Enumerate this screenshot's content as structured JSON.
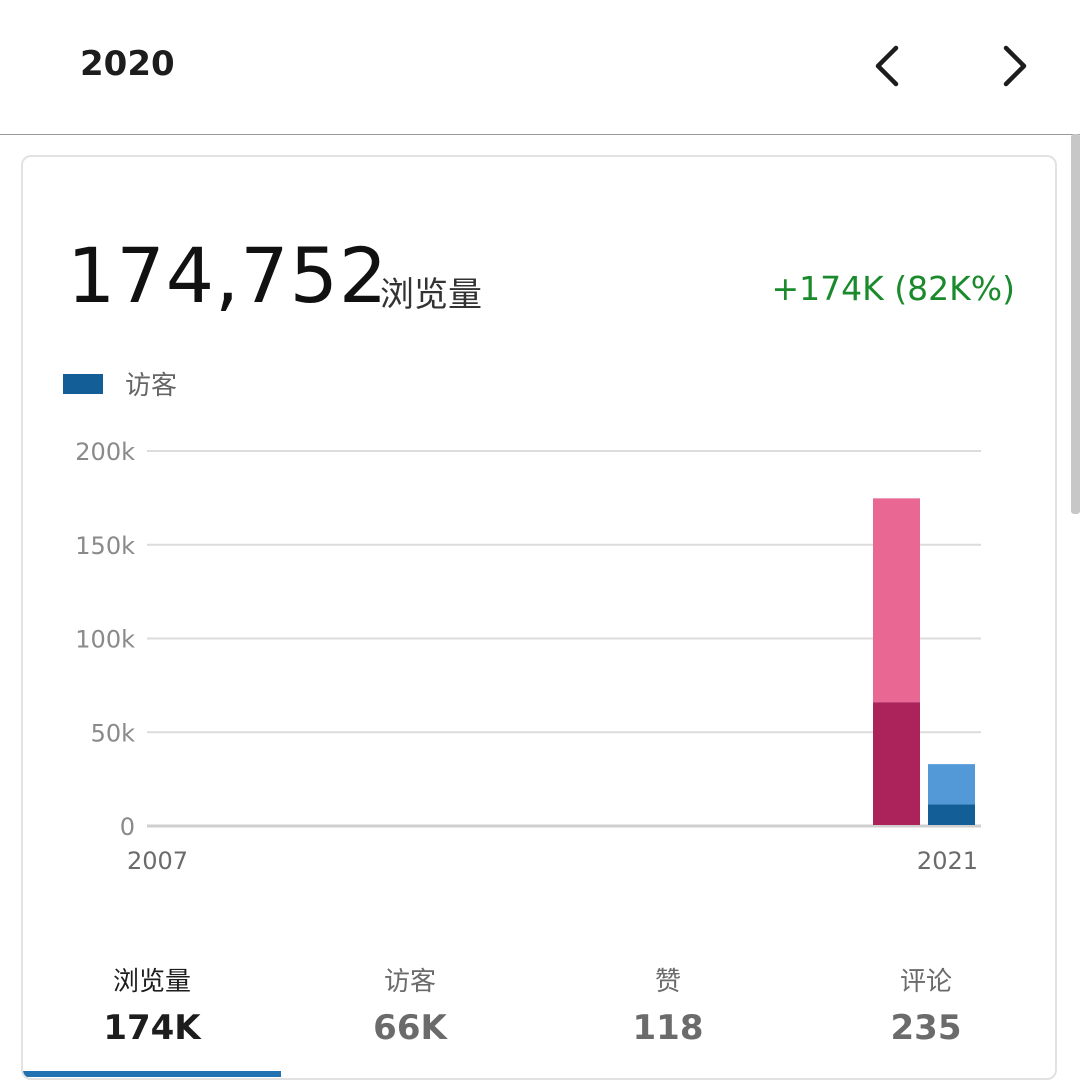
{
  "header": {
    "year": "2020",
    "prev_icon": "chevron-left-icon",
    "next_icon": "chevron-right-icon"
  },
  "summary": {
    "total": "174,752",
    "label": "浏览量",
    "change": "+174K (82K%)"
  },
  "legend": {
    "label": "访客",
    "color": "#135e96"
  },
  "colors": {
    "views_light": "#e96893",
    "views_dark": "#ab235a",
    "visitors_light": "#5399d7",
    "visitors_dark": "#135e96",
    "change_green": "#1a8a2c",
    "accent": "#2271b1"
  },
  "chart_data": {
    "type": "bar",
    "categories": [
      "2007",
      "2021"
    ],
    "ylim": [
      0,
      200000
    ],
    "yticks": [
      "0",
      "50k",
      "100k",
      "150k",
      "200k"
    ],
    "ytick_values": [
      0,
      50000,
      100000,
      150000,
      200000
    ],
    "series": [
      {
        "values": [
          0,
          174752
        ],
        "highlight_portion": [
          0,
          66000
        ]
      },
      {
        "values": [
          0,
          33000
        ],
        "highlight_portion": [
          0,
          11500
        ]
      }
    ]
  },
  "tabs": [
    {
      "label": "浏览量",
      "value": "174K",
      "active": true
    },
    {
      "label": "访客",
      "value": "66K",
      "active": false
    },
    {
      "label": "赞",
      "value": "118",
      "active": false
    },
    {
      "label": "评论",
      "value": "235",
      "active": false
    }
  ]
}
